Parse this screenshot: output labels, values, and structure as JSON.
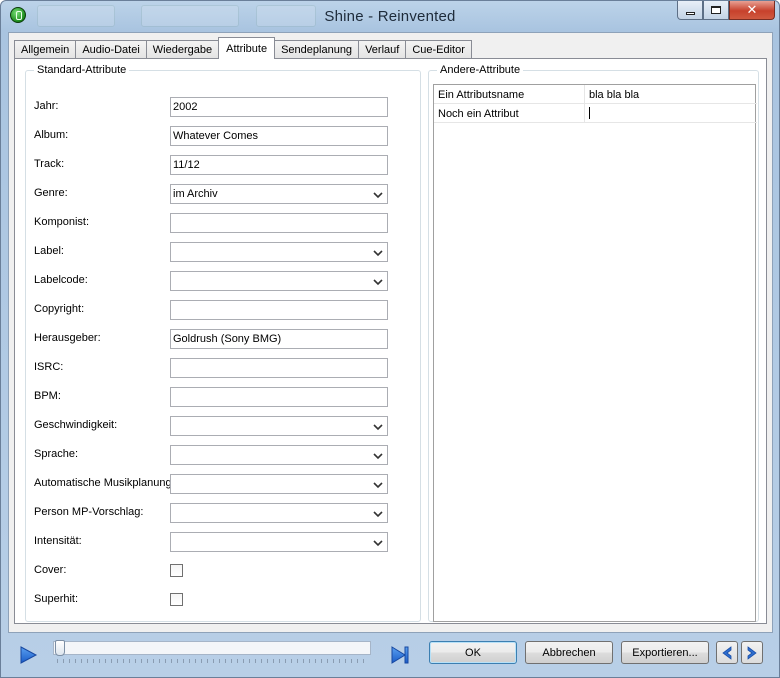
{
  "window": {
    "title": "Shine - Reinvented",
    "controls": {
      "minimize": "minimize",
      "maximize": "maximize",
      "close": "close"
    }
  },
  "tabs": [
    {
      "label": "Allgemein",
      "active": false
    },
    {
      "label": "Audio-Datei",
      "active": false
    },
    {
      "label": "Wiedergabe",
      "active": false
    },
    {
      "label": "Attribute",
      "active": true
    },
    {
      "label": "Sendeplanung",
      "active": false
    },
    {
      "label": "Verlauf",
      "active": false
    },
    {
      "label": "Cue-Editor",
      "active": false
    }
  ],
  "standard": {
    "legend": "Standard-Attribute",
    "fields": [
      {
        "label": "Jahr:",
        "value": "2002",
        "type": "text"
      },
      {
        "label": "Album:",
        "value": "Whatever Comes",
        "type": "text"
      },
      {
        "label": "Track:",
        "value": "11/12",
        "type": "text"
      },
      {
        "label": "Genre:",
        "value": "im Archiv",
        "type": "select"
      },
      {
        "label": "Komponist:",
        "value": "",
        "type": "text"
      },
      {
        "label": "Label:",
        "value": "",
        "type": "select"
      },
      {
        "label": "Labelcode:",
        "value": "",
        "type": "select"
      },
      {
        "label": "Copyright:",
        "value": "",
        "type": "text"
      },
      {
        "label": "Herausgeber:",
        "value": "Goldrush (Sony BMG)",
        "type": "text"
      },
      {
        "label": "ISRC:",
        "value": "",
        "type": "text"
      },
      {
        "label": "BPM:",
        "value": "",
        "type": "text"
      },
      {
        "label": "Geschwindigkeit:",
        "value": "",
        "type": "select"
      },
      {
        "label": "Sprache:",
        "value": "",
        "type": "select"
      },
      {
        "label": "Automatische Musikplanung:",
        "value": "",
        "type": "select"
      },
      {
        "label": "Person MP-Vorschlag:",
        "value": "",
        "type": "select"
      },
      {
        "label": "Intensität:",
        "value": "",
        "type": "select"
      },
      {
        "label": "Cover:",
        "checked": false,
        "type": "checkbox"
      },
      {
        "label": "Superhit:",
        "checked": false,
        "type": "checkbox"
      }
    ]
  },
  "other": {
    "legend": "Andere-Attribute",
    "rows": [
      {
        "name": "Ein Attributsname",
        "value": "bla bla bla"
      },
      {
        "name": "Noch ein Attribut",
        "value": ""
      }
    ]
  },
  "player": {
    "position_fraction": 0.0
  },
  "buttons": {
    "ok": "OK",
    "cancel": "Abbrechen",
    "export": "Exportieren..."
  },
  "colors": {
    "accent_blue": "#2f6fd0",
    "close_red": "#c7412c"
  },
  "icons": {
    "play": "play-icon",
    "skip": "skip-to-end-icon",
    "prev": "arrow-left-icon",
    "next": "arrow-right-icon",
    "chevron": "chevron-down-icon",
    "app": "app-icon"
  }
}
